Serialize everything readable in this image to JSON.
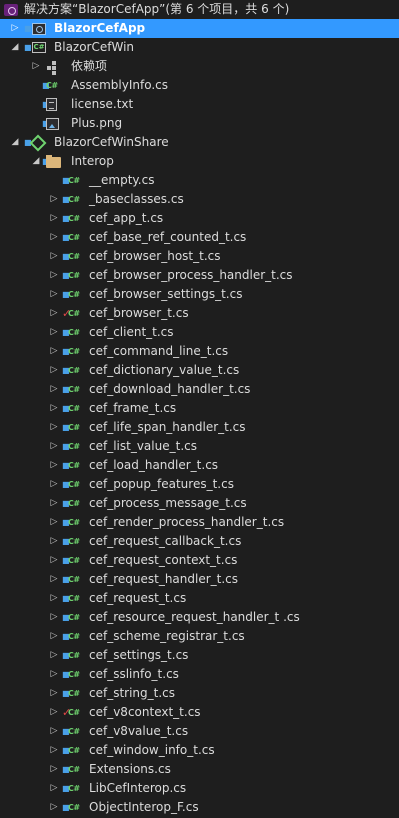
{
  "tree": [
    {
      "label": "解决方案“BlazorCefApp”(第 6 个项目，共 6 个)",
      "level": 0,
      "expander": "",
      "status": "",
      "icon": "solution-icon",
      "selected": false
    },
    {
      "label": "BlazorCefApp",
      "level": 0,
      "expander": "collapsed",
      "status": "lock",
      "icon": "web-project-icon",
      "selected": true
    },
    {
      "label": "BlazorCefWin",
      "level": 0,
      "expander": "expanded",
      "status": "lock",
      "icon": "csharp-project-icon",
      "selected": false
    },
    {
      "label": "依赖项",
      "level": 1,
      "expander": "collapsed",
      "status": "",
      "icon": "dependencies-icon",
      "selected": false
    },
    {
      "label": "AssemblyInfo.cs",
      "level": 1,
      "expander": "",
      "status": "lock",
      "icon": "csharp-file-icon",
      "selected": false
    },
    {
      "label": "license.txt",
      "level": 1,
      "expander": "",
      "status": "lock",
      "icon": "text-file-icon",
      "selected": false
    },
    {
      "label": "Plus.png",
      "level": 1,
      "expander": "",
      "status": "lock",
      "icon": "image-file-icon",
      "selected": false
    },
    {
      "label": "BlazorCefWinShare",
      "level": 0,
      "expander": "expanded",
      "status": "lock",
      "icon": "shared-project-icon",
      "selected": false
    },
    {
      "label": "Interop",
      "level": 1,
      "expander": "expanded",
      "status": "lock",
      "icon": "folder-icon",
      "selected": false
    },
    {
      "label": "__empty.cs",
      "level": 2,
      "expander": "",
      "status": "lock",
      "icon": "csharp-file-icon",
      "selected": false
    },
    {
      "label": "_baseclasses.cs",
      "level": 2,
      "expander": "collapsed",
      "status": "lock",
      "icon": "csharp-file-icon",
      "selected": false
    },
    {
      "label": "cef_app_t.cs",
      "level": 2,
      "expander": "collapsed",
      "status": "lock",
      "icon": "csharp-file-icon",
      "selected": false
    },
    {
      "label": "cef_base_ref_counted_t.cs",
      "level": 2,
      "expander": "collapsed",
      "status": "lock",
      "icon": "csharp-file-icon",
      "selected": false
    },
    {
      "label": "cef_browser_host_t.cs",
      "level": 2,
      "expander": "collapsed",
      "status": "lock",
      "icon": "csharp-file-icon",
      "selected": false
    },
    {
      "label": "cef_browser_process_handler_t.cs",
      "level": 2,
      "expander": "collapsed",
      "status": "lock",
      "icon": "csharp-file-icon",
      "selected": false
    },
    {
      "label": "cef_browser_settings_t.cs",
      "level": 2,
      "expander": "collapsed",
      "status": "lock",
      "icon": "csharp-file-icon",
      "selected": false
    },
    {
      "label": "cef_browser_t.cs",
      "level": 2,
      "expander": "collapsed",
      "status": "check",
      "icon": "csharp-file-icon",
      "selected": false
    },
    {
      "label": "cef_client_t.cs",
      "level": 2,
      "expander": "collapsed",
      "status": "lock",
      "icon": "csharp-file-icon",
      "selected": false
    },
    {
      "label": "cef_command_line_t.cs",
      "level": 2,
      "expander": "collapsed",
      "status": "lock",
      "icon": "csharp-file-icon",
      "selected": false
    },
    {
      "label": "cef_dictionary_value_t.cs",
      "level": 2,
      "expander": "collapsed",
      "status": "lock",
      "icon": "csharp-file-icon",
      "selected": false
    },
    {
      "label": "cef_download_handler_t.cs",
      "level": 2,
      "expander": "collapsed",
      "status": "lock",
      "icon": "csharp-file-icon",
      "selected": false
    },
    {
      "label": "cef_frame_t.cs",
      "level": 2,
      "expander": "collapsed",
      "status": "lock",
      "icon": "csharp-file-icon",
      "selected": false
    },
    {
      "label": "cef_life_span_handler_t.cs",
      "level": 2,
      "expander": "collapsed",
      "status": "lock",
      "icon": "csharp-file-icon",
      "selected": false
    },
    {
      "label": "cef_list_value_t.cs",
      "level": 2,
      "expander": "collapsed",
      "status": "lock",
      "icon": "csharp-file-icon",
      "selected": false
    },
    {
      "label": "cef_load_handler_t.cs",
      "level": 2,
      "expander": "collapsed",
      "status": "lock",
      "icon": "csharp-file-icon",
      "selected": false
    },
    {
      "label": "cef_popup_features_t.cs",
      "level": 2,
      "expander": "collapsed",
      "status": "lock",
      "icon": "csharp-file-icon",
      "selected": false
    },
    {
      "label": "cef_process_message_t.cs",
      "level": 2,
      "expander": "collapsed",
      "status": "lock",
      "icon": "csharp-file-icon",
      "selected": false
    },
    {
      "label": "cef_render_process_handler_t.cs",
      "level": 2,
      "expander": "collapsed",
      "status": "lock",
      "icon": "csharp-file-icon",
      "selected": false
    },
    {
      "label": "cef_request_callback_t.cs",
      "level": 2,
      "expander": "collapsed",
      "status": "lock",
      "icon": "csharp-file-icon",
      "selected": false
    },
    {
      "label": "cef_request_context_t.cs",
      "level": 2,
      "expander": "collapsed",
      "status": "lock",
      "icon": "csharp-file-icon",
      "selected": false
    },
    {
      "label": "cef_request_handler_t.cs",
      "level": 2,
      "expander": "collapsed",
      "status": "lock",
      "icon": "csharp-file-icon",
      "selected": false
    },
    {
      "label": "cef_request_t.cs",
      "level": 2,
      "expander": "collapsed",
      "status": "lock",
      "icon": "csharp-file-icon",
      "selected": false
    },
    {
      "label": "cef_resource_request_handler_t .cs",
      "level": 2,
      "expander": "collapsed",
      "status": "lock",
      "icon": "csharp-file-icon",
      "selected": false
    },
    {
      "label": "cef_scheme_registrar_t.cs",
      "level": 2,
      "expander": "collapsed",
      "status": "lock",
      "icon": "csharp-file-icon",
      "selected": false
    },
    {
      "label": "cef_settings_t.cs",
      "level": 2,
      "expander": "collapsed",
      "status": "lock",
      "icon": "csharp-file-icon",
      "selected": false
    },
    {
      "label": "cef_sslinfo_t.cs",
      "level": 2,
      "expander": "collapsed",
      "status": "lock",
      "icon": "csharp-file-icon",
      "selected": false
    },
    {
      "label": "cef_string_t.cs",
      "level": 2,
      "expander": "collapsed",
      "status": "lock",
      "icon": "csharp-file-icon",
      "selected": false
    },
    {
      "label": "cef_v8context_t.cs",
      "level": 2,
      "expander": "collapsed",
      "status": "check",
      "icon": "csharp-file-icon",
      "selected": false
    },
    {
      "label": "cef_v8value_t.cs",
      "level": 2,
      "expander": "collapsed",
      "status": "lock",
      "icon": "csharp-file-icon",
      "selected": false
    },
    {
      "label": "cef_window_info_t.cs",
      "level": 2,
      "expander": "collapsed",
      "status": "lock",
      "icon": "csharp-file-icon",
      "selected": false
    },
    {
      "label": "Extensions.cs",
      "level": 2,
      "expander": "collapsed",
      "status": "lock",
      "icon": "csharp-file-icon",
      "selected": false
    },
    {
      "label": "LibCefInterop.cs",
      "level": 2,
      "expander": "collapsed",
      "status": "lock",
      "icon": "csharp-file-icon",
      "selected": false
    },
    {
      "label": "ObjectInterop_F.cs",
      "level": 2,
      "expander": "collapsed",
      "status": "lock",
      "icon": "csharp-file-icon",
      "selected": false
    }
  ],
  "colors": {
    "background": "#1e1e1e",
    "selection": "#3399ff",
    "text": "#dcdcdc",
    "lock": "#4aa0e8",
    "check": "#e04848",
    "csharp": "#6fd36f",
    "folder": "#dcb67a"
  }
}
